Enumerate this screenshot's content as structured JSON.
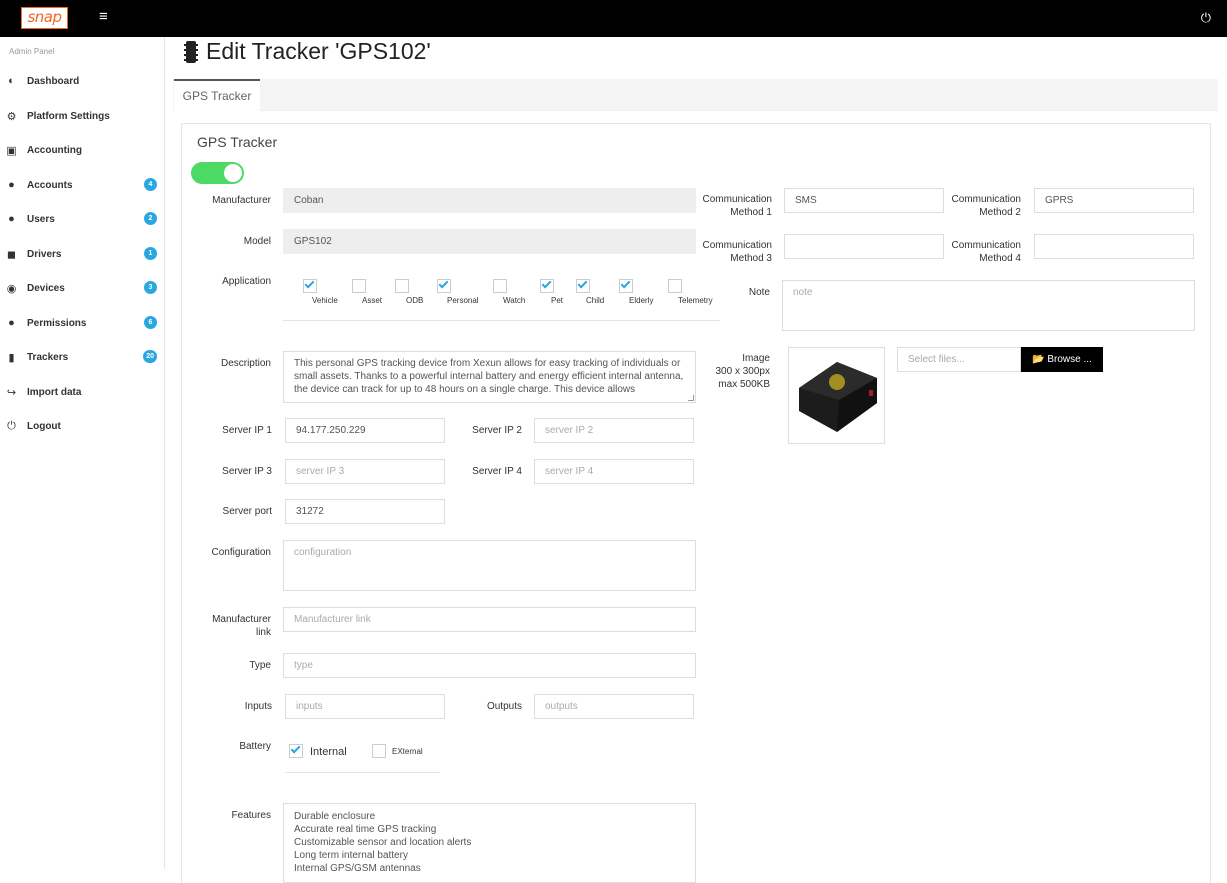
{
  "topbar": {
    "logo": "snap",
    "menu_icon": "hamburger-icon",
    "power_icon": "power-icon"
  },
  "sidebar": {
    "admin_label": "Admin Panel",
    "items": [
      {
        "label": "Dashboard",
        "icon": "dashboard-icon",
        "badge": ""
      },
      {
        "label": "Platform Settings",
        "icon": "cogs-icon",
        "badge": ""
      },
      {
        "label": "Accounting",
        "icon": "money-icon",
        "badge": ""
      },
      {
        "label": "Accounts",
        "icon": "user-icon",
        "badge": "4"
      },
      {
        "label": "Users",
        "icon": "users-icon",
        "badge": "2"
      },
      {
        "label": "Drivers",
        "icon": "car-icon",
        "badge": "1"
      },
      {
        "label": "Devices",
        "icon": "compass-icon",
        "badge": "3"
      },
      {
        "label": "Permissions",
        "icon": "user-cog-icon",
        "badge": "6"
      },
      {
        "label": "Trackers",
        "icon": "chip-icon",
        "badge": "20"
      },
      {
        "label": "Import data",
        "icon": "import-icon",
        "badge": ""
      },
      {
        "label": "Logout",
        "icon": "power-icon",
        "badge": ""
      }
    ]
  },
  "page": {
    "title": "Edit Tracker 'GPS102'",
    "tab": "GPS Tracker",
    "panel_title": "GPS Tracker",
    "enabled": true
  },
  "form": {
    "manufacturer": {
      "label": "Manufacturer",
      "value": "Coban"
    },
    "model": {
      "label": "Model",
      "value": "GPS102"
    },
    "comm1": {
      "label": "Communication Method 1",
      "value": "SMS"
    },
    "comm2": {
      "label": "Communication Method 2",
      "value": "GPRS"
    },
    "comm3": {
      "label": "Communication Method 3",
      "value": ""
    },
    "comm4": {
      "label": "Communication Method 4",
      "value": ""
    },
    "application": {
      "label": "Application",
      "options": [
        {
          "label": "Vehicle",
          "checked": true
        },
        {
          "label": "Asset",
          "checked": false
        },
        {
          "label": "ODB",
          "checked": false
        },
        {
          "label": "Personal",
          "checked": true
        },
        {
          "label": "Watch",
          "checked": false
        },
        {
          "label": "Pet",
          "checked": true
        },
        {
          "label": "Child",
          "checked": true
        },
        {
          "label": "Elderly",
          "checked": true
        },
        {
          "label": "Telemetry",
          "checked": false
        }
      ]
    },
    "note": {
      "label": "Note",
      "placeholder": "note"
    },
    "description": {
      "label": "Description",
      "value": "This personal GPS tracking device from Xexun allows for easy tracking of individuals or small assets. Thanks to a powerful internal battery and energy efficient internal antenna, the device can track for up to 48 hours on a single charge. This device allows"
    },
    "image": {
      "label_1": "Image",
      "label_2": "300 x 300px",
      "label_3": "max 500KB",
      "select_placeholder": "Select files...",
      "browse": "Browse ..."
    },
    "server_ip1": {
      "label": "Server IP 1",
      "value": "94.177.250.229"
    },
    "server_ip2": {
      "label": "Server IP 2",
      "placeholder": "server IP 2"
    },
    "server_ip3": {
      "label": "Server IP 3",
      "placeholder": "server IP 3"
    },
    "server_ip4": {
      "label": "Server IP 4",
      "placeholder": "server IP 4"
    },
    "server_port": {
      "label": "Server port",
      "value": "31272"
    },
    "configuration": {
      "label": "Configuration",
      "placeholder": "configuration"
    },
    "manufacturer_link": {
      "label_1": "Manufacturer",
      "label_2": "link",
      "placeholder": "Manufacturer link"
    },
    "type": {
      "label": "Type",
      "placeholder": "type"
    },
    "inputs": {
      "label": "Inputs",
      "placeholder": "inputs"
    },
    "outputs": {
      "label": "Outputs",
      "placeholder": "outputs"
    },
    "battery": {
      "label": "Battery",
      "options": [
        {
          "label": "Internal",
          "checked": true
        },
        {
          "label": "EXternal",
          "checked": false
        }
      ]
    },
    "features": {
      "label": "Features",
      "lines": [
        "Durable enclosure",
        "Accurate real time GPS tracking",
        "Customizable sensor and location alerts",
        "Long term internal battery",
        "Internal GPS/GSM antennas"
      ]
    }
  }
}
